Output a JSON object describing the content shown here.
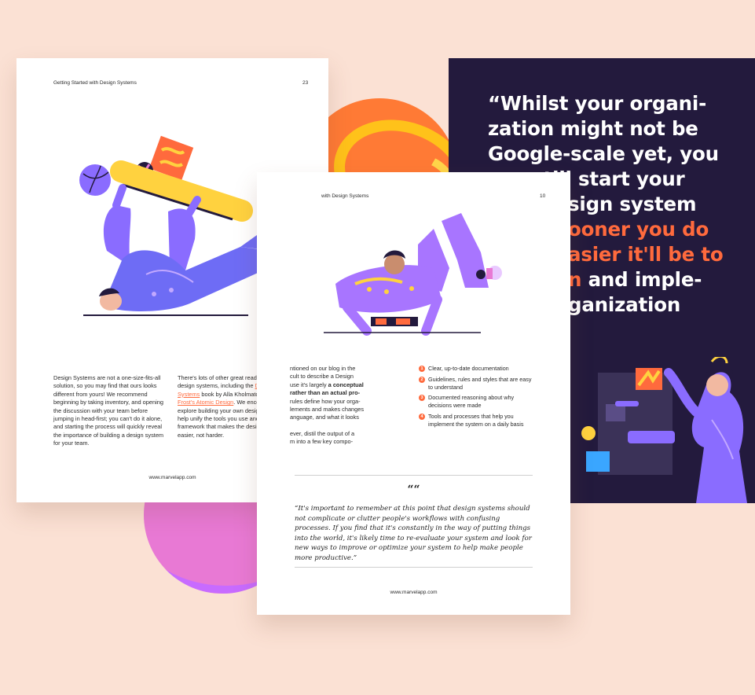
{
  "left_page": {
    "running_title": "Getting Started with Design Systems",
    "page_number": "23",
    "col1": "Design Systems are not a one-size-fits-all solution, so you may find that ours looks different from yours! We recommend beginning by taking inventory, and opening the discussion with your team before jumping in head-first; you can't do it alone, and starting the process will quickly reveal the importance of building a design system for your team.",
    "col2_a": "There's lots of other great reading about design systems, including the ",
    "col2_link1": "Design Systems",
    "col2_b": " book by Alla Kholmatova, and ",
    "col2_link2": "Brad Frost's Atomic Design",
    "col2_c": ". We encourage you to explore building your own design system; it'll help unify the tools you use and build a framework that makes the design process easier, not harder.",
    "footer_url": "www.marvelapp.com"
  },
  "right_page": {
    "running_title": "with Design Systems",
    "page_number": "10",
    "body_a": "ntioned on our blog in the ",
    "body_b": "cult to describe a Design ",
    "body_c": "use it's largely ",
    "body_bold1": "a conceptual",
    "body_bold2": "rather than an actual pro-",
    "body_d": "rules define how your orga-",
    "body_e": "lements and makes changes",
    "body_f": "anguage, and what it looks",
    "body_g": "ever, distil the output of a",
    "body_h": "m into a few key compo-",
    "bullets": [
      "Clear, up-to-date documentation",
      "Guidelines, rules and styles that are easy to understand",
      "Documented reasoning about why decisions were made",
      "Tools and processes that help you implement the system on a daily basis"
    ],
    "quote_mark": "““",
    "quote": "“It's important to remember at this point that design systems should not complicate or clutter people's workflows with confusing processes. If you find that it's constantly in the way of putting things into the world, it's likely time to re-evaluate your system and look for new ways to improve or optimize your system to help make people more productive.”",
    "footer_url": "www.marvelapp.com"
  },
  "dark_panel": {
    "line1": "“Whilst your organi-",
    "line2": "zation might not be",
    "line3": "Google-scale yet, you",
    "line4": "can still start your",
    "line5": "sign system",
    "line6_hl": "ooner you do",
    "line7_hl": "asier it'll be to",
    "line8_hl": "n",
    "line8_rest": " and imple-",
    "line9": "ganization"
  },
  "colors": {
    "background": "#fbe1d4",
    "dark_panel": "#231a3d",
    "accent_orange": "#ff6a3d",
    "illustration_purple": "#8a6cff",
    "illustration_yellow": "#ffd23f"
  }
}
